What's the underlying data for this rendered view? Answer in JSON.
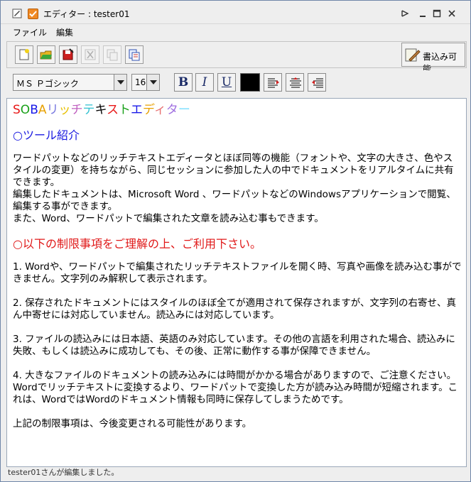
{
  "window": {
    "title": "エディター : tester01"
  },
  "menu": {
    "file": "ファイル",
    "edit": "編集"
  },
  "toolbar": {
    "write_label": "書込み可能"
  },
  "format": {
    "font_value": "ＭＳ Ｐゴシック",
    "size_value": "16",
    "bold_label": "B",
    "italic_label": "I",
    "underline_label": "U",
    "text_color": "#000000"
  },
  "editor": {
    "heading_prefix": "SOBA",
    "heading_chars": [
      {
        "ch": "リ",
        "color": "#7a7ae0"
      },
      {
        "ch": "ッ",
        "color": "#e8c000"
      },
      {
        "ch": "チ",
        "color": "#c060c0"
      },
      {
        "ch": "テ",
        "color": "#30c0d0"
      },
      {
        "ch": "キ",
        "color": "#000000"
      },
      {
        "ch": "ス",
        "color": "#e81818"
      },
      {
        "ch": "ト",
        "color": "#18a018"
      },
      {
        "ch": "エ",
        "color": "#1818e8"
      },
      {
        "ch": "デ",
        "color": "#e8a000"
      },
      {
        "ch": "ィ",
        "color": "#e87070"
      },
      {
        "ch": "タ",
        "color": "#a070e0"
      },
      {
        "ch": "ー",
        "color": "#80e0ff"
      }
    ],
    "section1_title": "○ツール紹介",
    "section1_p1": "ワードパットなどのリッチテキストエディータとほぼ同等の機能（フォントや、文字の大きさ、色やスタイルの変更）を持ちながら、同じセッションに参加した人の中でドキュメントをリアルタイムに共有できます。\n編集したドキュメントは、Microsoft Word 、ワードパットなどのWindowsアプリケーションで閲覧、編集する事ができます。\nまた、Word、ワードパットで編集された文章を読み込む事もできます。",
    "section2_title": "○以下の制限事項をご理解の上、ご利用下さい。",
    "item1": "1. Wordや、ワードパットで編集されたリッチテキストファイルを開く時、写真や画像を読み込む事ができません。文字列のみ解釈して表示されます。",
    "item2": "2. 保存されたドキュメントにはスタイルのほぼ全てが適用されて保存されますが、文字列の右寄せ、真ん中寄せには対応していません。読込みには対応しています。",
    "item3": "3. ファイルの読込みには日本語、英語のみ対応しています。その他の言語を利用された場合、読込みに失敗、もしくは読込みに成功しても、その後、正常に動作する事が保障できません。",
    "item4": "4. 大きなファイルのドキュメントの読み込みには時間がかかる場合がありますので、ご注意ください。Wordでリッチテキストに変換するより、ワードパットで変換した方が読み込み時間が短縮されます。これは、WordではWordのドキュメント情報も同時に保存してしまうためです。",
    "footer_note": "上記の制限事項は、今後変更される可能性があります。"
  },
  "status": {
    "text": "tester01さんが編集しました。"
  },
  "colors": {
    "section1": "#1a1ae0",
    "section2": "#e01818",
    "soba_S": "#e81818",
    "soba_O": "#18a018",
    "soba_B": "#1818e8",
    "soba_A": "#e8a000"
  }
}
